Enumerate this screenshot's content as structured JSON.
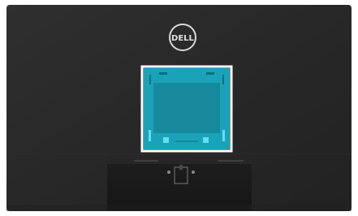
{
  "photo": {
    "subject": "monitor-back-panel",
    "brand_logo_text": "DELL",
    "highlight_color": "#1AA3B8",
    "highlight_border": "#FFFFFF",
    "panel_color": "#2B2B2B"
  }
}
